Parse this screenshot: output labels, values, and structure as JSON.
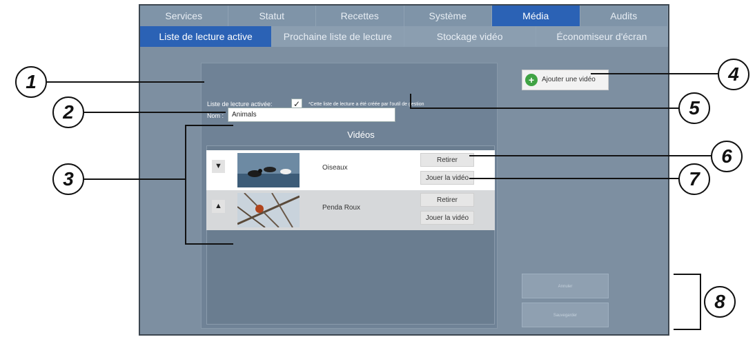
{
  "tabs_row1": [
    "Services",
    "Statut",
    "Recettes",
    "Système",
    "Média",
    "Audits"
  ],
  "tabs_row2": [
    "Liste de lecture active",
    "Prochaine liste de lecture",
    "Stockage vidéo",
    "Économiseur d'écran"
  ],
  "active_tab_row1": "Média",
  "active_tab_row2": "Liste de lecture active",
  "form": {
    "active_label": "Liste de lecture activée:",
    "active_checked": "✓",
    "note": "*Cette liste de lecture a été créée par l'outil de gestion",
    "name_label": "Nom :",
    "name_value": "Animals",
    "videos_title": "Vidéos"
  },
  "videos": [
    {
      "arrow": "▼",
      "title": "Oiseaux",
      "remove": "Retirer",
      "play": "Jouer la vidéo"
    },
    {
      "arrow": "▲",
      "title": "Penda Roux",
      "remove": "Retirer",
      "play": "Jouer la vidéo"
    }
  ],
  "actions": {
    "add_video": "Ajouter une vidéo",
    "cancel": "Annuler",
    "save": "Sauvegarder"
  },
  "callouts": [
    "1",
    "2",
    "3",
    "4",
    "5",
    "6",
    "7",
    "8"
  ],
  "colors": {
    "accent": "#2b62b5",
    "add_icon": "#3fa344"
  }
}
